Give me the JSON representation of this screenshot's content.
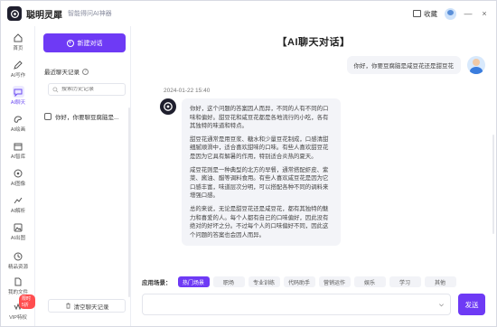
{
  "app": {
    "name": "聪明灵犀",
    "subtitle": "智能得问AI神器",
    "favorite_label": "收藏",
    "window_controls": [
      "—",
      "×"
    ]
  },
  "sidebar": {
    "items": [
      {
        "label": "首页",
        "icon": "home-icon"
      },
      {
        "label": "AI写作",
        "icon": "pen-icon"
      },
      {
        "label": "AI聊天",
        "icon": "chat-icon"
      },
      {
        "label": "AI绘画",
        "icon": "paint-icon"
      },
      {
        "label": "AI智库",
        "icon": "library-icon"
      },
      {
        "label": "AI图像",
        "icon": "image-icon"
      },
      {
        "label": "AI解析",
        "icon": "analyze-icon"
      },
      {
        "label": "AI出图",
        "icon": "picture-icon"
      },
      {
        "label": "精品资源",
        "icon": "resource-icon"
      },
      {
        "label": "我的文件",
        "icon": "file-icon"
      },
      {
        "label": "VIP特权",
        "icon": "vip-icon",
        "badge": "限时5折"
      }
    ],
    "active_index": 2
  },
  "conversations": {
    "new_button": "新建对话",
    "recent_title": "最近聊天记录",
    "search_placeholder": "搜索历史记录",
    "items": [
      {
        "title": "你好，你要聊豆腐脑是..."
      }
    ],
    "clear_button": "清空聊天记录"
  },
  "chat": {
    "title": "【AI聊天对话】",
    "user_message": "你好，你要豆腐脑是咸豆花还是甜豆花",
    "timestamp": "2024-01-22 15:40",
    "bot_paragraphs": [
      "你好，这个问题的答案因人而异，不同的人有不同的口味和偏好。甜豆花和咸豆花都是各地流行的小吃，各有其独特的味道和特点。",
      "甜豆花通常是用豆浆、糖水和少量豆花制成，口感清甜细腻顺滑中，适合喜欢甜味的口味。有些人喜欢甜豆花是因为它具有解暑的作用，特别适合炎热的夏天。",
      "咸豆花则是一种典型的北方的早餐，通常搭配虾皮、紫菜、酱油、醋等调料食用。有些人喜欢咸豆花是因为它口感丰富，味道层次分明，可以搭配各种不同的调料来增强口感。",
      "总的来说，无论是甜豆花还是咸豆花，都有其独特的魅力和喜爱的人。每个人都有自己的口味偏好，因此没有绝对的好坏之分。不过每个人的口味偏好不同，因此这个问题的答案也会因人而异。"
    ],
    "scene_label": "应用场景：",
    "scenes": [
      "热门场景",
      "职场",
      "专业训练",
      "代码助手",
      "营销运作",
      "娱乐",
      "学习",
      "其他"
    ],
    "active_scene": 0,
    "input_placeholder": "",
    "send_label": "发送"
  },
  "colors": {
    "accent": "#6e3af5",
    "bubble": "#f3f4f8",
    "badge": "#ff4d4f"
  }
}
